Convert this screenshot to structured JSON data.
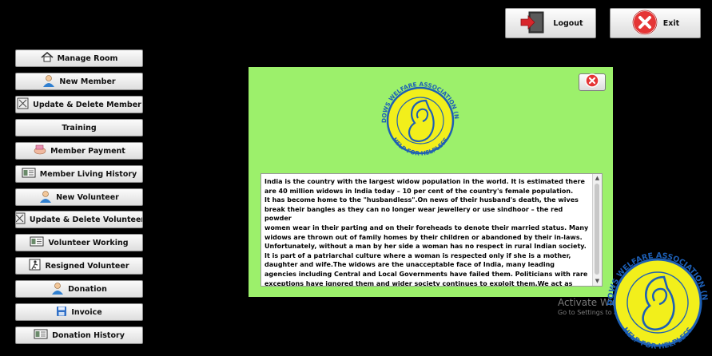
{
  "top_buttons": {
    "logout_label": "Logout",
    "exit_label": "Exit"
  },
  "sidebar": {
    "items": [
      {
        "label": "Manage Room",
        "icon": "home-icon"
      },
      {
        "label": "New Member",
        "icon": "user-icon"
      },
      {
        "label": "Update & Delete Member",
        "icon": "edit-document-icon"
      },
      {
        "label": "Training",
        "icon": ""
      },
      {
        "label": "Member Payment",
        "icon": "payment-hand-icon"
      },
      {
        "label": "Member Living History",
        "icon": "history-ledger-icon"
      },
      {
        "label": "New Volunteer",
        "icon": "user-icon"
      },
      {
        "label": "Update & Delete Volunteer",
        "icon": "edit-document-icon"
      },
      {
        "label": "Volunteer Working",
        "icon": "history-ledger-icon"
      },
      {
        "label": "Resigned Volunteer",
        "icon": "resign-figure-icon"
      },
      {
        "label": "Donation",
        "icon": "user-icon"
      },
      {
        "label": "Invoice",
        "icon": "floppy-disk-icon"
      },
      {
        "label": "Donation History",
        "icon": "history-ledger-icon"
      }
    ]
  },
  "logo": {
    "top_text": "WIDOWS WELFARE ASSOCIATION (NGO)",
    "bottom_text": "HELP FOR HELPLESS"
  },
  "info_lines": [
    "India is the country with the largest widow population in the world. It is estimated there",
    " are 40 million widows in India today – 10 per cent of the country's female population.",
    "It has become home to the \"husbandless\".On news of their husband's death, the wives",
    "break their bangles as they can no longer wear jewellery or use sindhoor – the red powder",
    " women wear in their parting and on their foreheads to denote their married status. Many",
    " widows are thrown out of family homes by their children or abandoned by their in-laws.",
    "Unfortunately, without a man by her side a woman has no respect in rural Indian society.",
    " It is part of a patriarchal culture where a woman is respected only if she is a mother,",
    " daughter and wife.The widows are the unacceptable face of India, many leading",
    "agencies including Central and Local Governments have failed them. Politicians with rare",
    "exceptions have ignored them and wider society continues to exploit them.We act as"
  ],
  "watermark": {
    "title": "Activate Windows",
    "subtitle": "Go to Settings to activate Windows."
  },
  "colors": {
    "panel": "#9cf06b",
    "logo_yellow": "#f2ef1b",
    "logo_blue": "#1d5fb5"
  }
}
